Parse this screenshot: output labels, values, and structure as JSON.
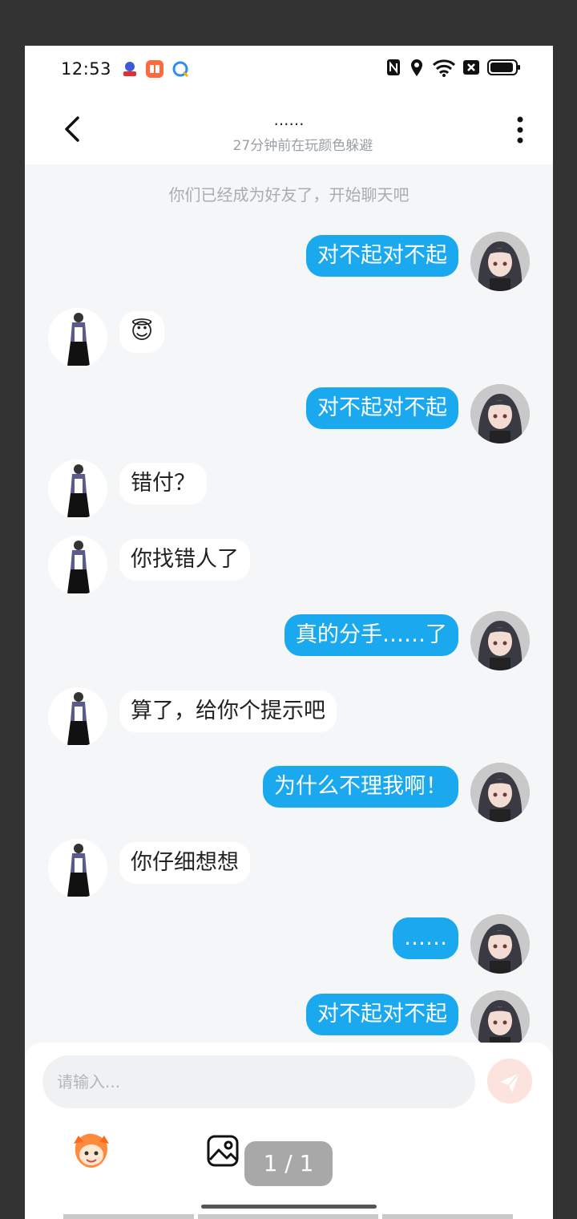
{
  "status_bar": {
    "time": "12:53",
    "notification_icons": [
      "baidu-app-icon",
      "book-app-icon",
      "browser-app-icon"
    ],
    "system_icons": [
      "nfc-icon",
      "location-icon",
      "wifi-icon",
      "sim-off-icon",
      "battery-icon"
    ]
  },
  "header": {
    "title": "……",
    "subtitle": "27分钟前在玩颜色躲避"
  },
  "chat": {
    "system_message": "你们已经成为好友了，开始聊天吧",
    "messages": [
      {
        "side": "out",
        "text": "对不起对不起"
      },
      {
        "side": "in",
        "text": "😇"
      },
      {
        "side": "out",
        "text": "对不起对不起"
      },
      {
        "side": "in",
        "text": "错付？"
      },
      {
        "side": "in",
        "text": "你找错人了"
      },
      {
        "side": "out",
        "text": "真的分手……了"
      },
      {
        "side": "in",
        "text": " 算了，给你个提示吧"
      },
      {
        "side": "out",
        "text": "为什么不理我啊！"
      },
      {
        "side": "in",
        "text": "你仔细想想"
      },
      {
        "side": "out",
        "text": "……"
      },
      {
        "side": "out",
        "text": "对不起对不起"
      }
    ]
  },
  "composer": {
    "placeholder": "请输入...",
    "pager": "1 / 1"
  },
  "colors": {
    "accent_bubble": "#1aa9ef",
    "send_button": "#fde3dd"
  }
}
